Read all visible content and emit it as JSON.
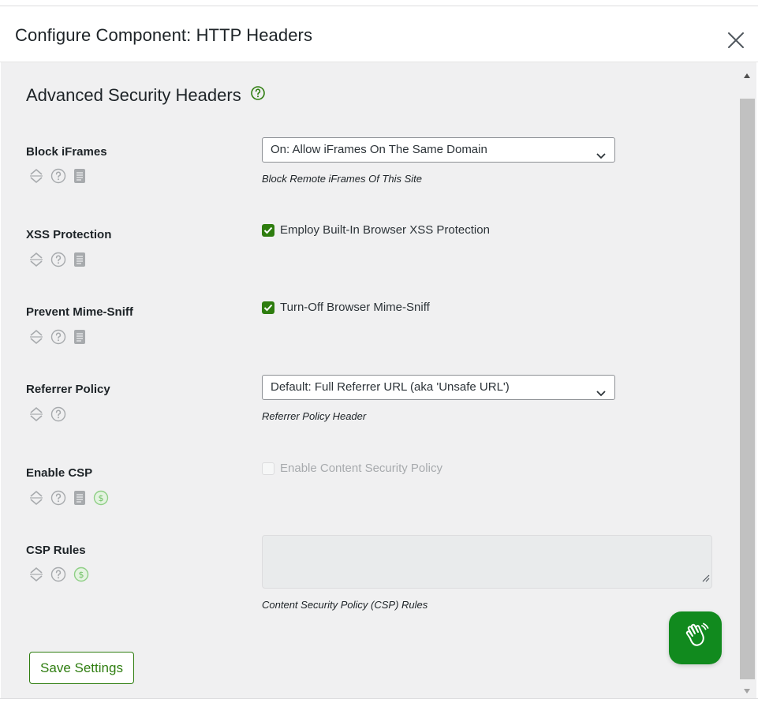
{
  "modal": {
    "title": "Configure Component: HTTP Headers",
    "close_icon": "close-icon"
  },
  "section": {
    "title": "Advanced Security Headers",
    "help_icon": "help-circle-icon",
    "accent_color": "#2e7d0f"
  },
  "rows": [
    {
      "label": "Block iFrames",
      "control": "select",
      "value": "On: Allow iFrames On The Same Domain",
      "description": "Block Remote iFrames Of This Site",
      "icons": [
        "sort-icon",
        "help-icon",
        "document-icon"
      ]
    },
    {
      "label": "XSS Protection",
      "control": "checkbox",
      "checked": true,
      "checkbox_label": "Employ Built-In Browser XSS Protection",
      "icons": [
        "sort-icon",
        "help-icon",
        "document-icon"
      ]
    },
    {
      "label": "Prevent Mime-Sniff",
      "control": "checkbox",
      "checked": true,
      "checkbox_label": "Turn-Off Browser Mime-Sniff",
      "icons": [
        "sort-icon",
        "help-icon",
        "document-icon"
      ]
    },
    {
      "label": "Referrer Policy",
      "control": "select",
      "value": "Default: Full Referrer URL (aka 'Unsafe URL')",
      "description": "Referrer Policy Header",
      "icons": [
        "sort-icon",
        "help-icon"
      ]
    },
    {
      "label": "Enable CSP",
      "control": "checkbox",
      "checked": false,
      "disabled": true,
      "checkbox_label": "Enable Content Security Policy",
      "icons": [
        "sort-icon",
        "help-icon",
        "document-icon",
        "premium-dollar-icon"
      ]
    },
    {
      "label": "CSP Rules",
      "control": "textarea",
      "value": "",
      "description": "Content Security Policy (CSP) Rules",
      "icons": [
        "sort-icon",
        "help-icon",
        "premium-dollar-icon"
      ]
    }
  ],
  "actions": {
    "save_label": "Save Settings"
  },
  "chat_widget": {
    "icon": "waving-hand-icon",
    "color": "#118a1e"
  }
}
